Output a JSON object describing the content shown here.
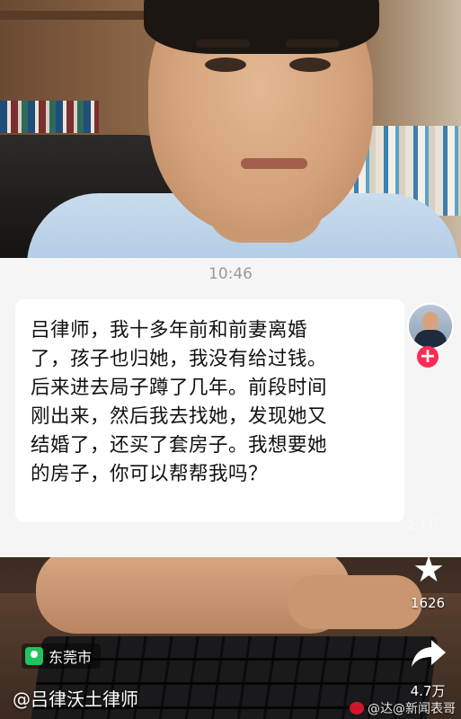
{
  "message": {
    "time": "10:46",
    "lines": [
      "吕律师，我十多年前和前妻离婚",
      "了，孩子也归她，我没有给过钱。",
      "后来进去局子蹲了几年。前段时间",
      "刚出来，然后我去找她，发现她又",
      "结婚了，还买了套房子。我想要她",
      "的房子，你可以帮帮我吗？"
    ]
  },
  "sidebar": {
    "follow_symbol": "+",
    "faded_count": "2.7万",
    "favorite_count": "1626",
    "share_count": "4.7万"
  },
  "location": {
    "label": "东莞市"
  },
  "author": {
    "handle": "@吕律沃土律师"
  },
  "watermark": {
    "text": "@达@新闻表哥"
  },
  "icons": {
    "favorite": "star-icon",
    "share": "share-arrow-icon",
    "location": "location-pin-icon"
  },
  "colors": {
    "follow_button": "#fe2c55",
    "location_pin": "#21c35f"
  }
}
